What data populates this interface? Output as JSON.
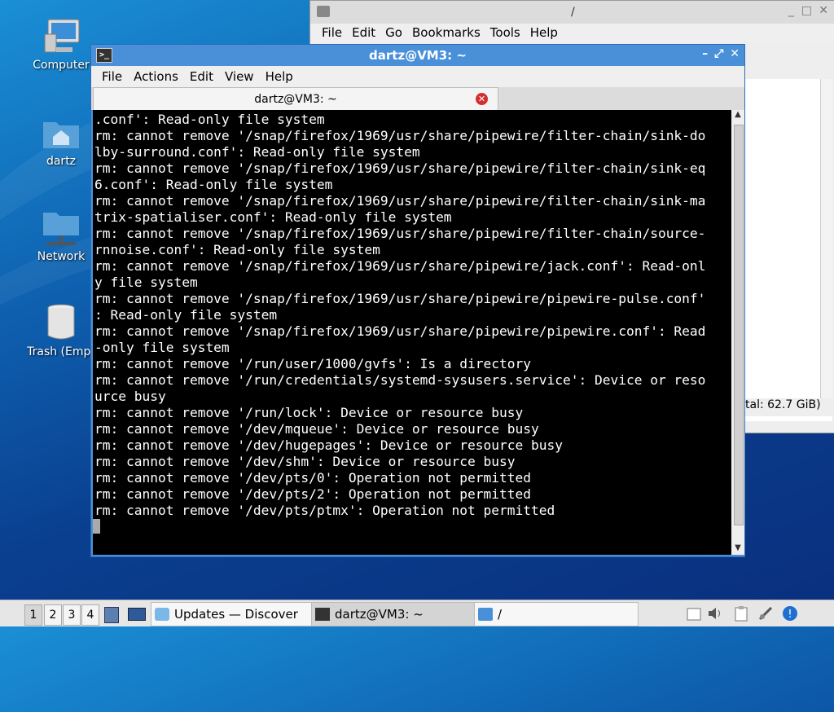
{
  "desktop": {
    "icons": [
      {
        "label": "Computer"
      },
      {
        "label": "dartz"
      },
      {
        "label": "Network"
      },
      {
        "label": "Trash (Empt"
      }
    ]
  },
  "file_manager": {
    "title": "/",
    "menu": [
      "File",
      "Edit",
      "Go",
      "Bookmarks",
      "Tools",
      "Help"
    ],
    "status": "tal: 62.7 GiB)"
  },
  "terminal": {
    "title": "dartz@VM3: ~",
    "menu": [
      "File",
      "Actions",
      "Edit",
      "View",
      "Help"
    ],
    "tab_label": "dartz@VM3: ~",
    "lines": [
      ".conf': Read-only file system",
      "rm: cannot remove '/snap/firefox/1969/usr/share/pipewire/filter-chain/sink-do",
      "lby-surround.conf': Read-only file system",
      "rm: cannot remove '/snap/firefox/1969/usr/share/pipewire/filter-chain/sink-eq",
      "6.conf': Read-only file system",
      "rm: cannot remove '/snap/firefox/1969/usr/share/pipewire/filter-chain/sink-ma",
      "trix-spatialiser.conf': Read-only file system",
      "rm: cannot remove '/snap/firefox/1969/usr/share/pipewire/filter-chain/source-",
      "rnnoise.conf': Read-only file system",
      "rm: cannot remove '/snap/firefox/1969/usr/share/pipewire/jack.conf': Read-onl",
      "y file system",
      "rm: cannot remove '/snap/firefox/1969/usr/share/pipewire/pipewire-pulse.conf'",
      ": Read-only file system",
      "rm: cannot remove '/snap/firefox/1969/usr/share/pipewire/pipewire.conf': Read",
      "-only file system",
      "rm: cannot remove '/run/user/1000/gvfs': Is a directory",
      "rm: cannot remove '/run/credentials/systemd-sysusers.service': Device or reso",
      "urce busy",
      "rm: cannot remove '/run/lock': Device or resource busy",
      "rm: cannot remove '/dev/mqueue': Device or resource busy",
      "rm: cannot remove '/dev/hugepages': Device or resource busy",
      "rm: cannot remove '/dev/shm': Device or resource busy",
      "rm: cannot remove '/dev/pts/0': Operation not permitted",
      "rm: cannot remove '/dev/pts/2': Operation not permitted",
      "rm: cannot remove '/dev/pts/ptmx': Operation not permitted"
    ]
  },
  "taskbar": {
    "workspaces": [
      "1",
      "2",
      "3",
      "4"
    ],
    "active_workspace": "1",
    "tasks": [
      {
        "label": "Updates — Discover",
        "icon": "discover-icon"
      },
      {
        "label": "dartz@VM3: ~",
        "icon": "terminal-icon"
      },
      {
        "label": "/",
        "icon": "folder-icon"
      }
    ],
    "tray_icons": [
      "notes-icon",
      "volume-icon",
      "clipboard-icon",
      "network-icon",
      "updates-icon"
    ]
  }
}
